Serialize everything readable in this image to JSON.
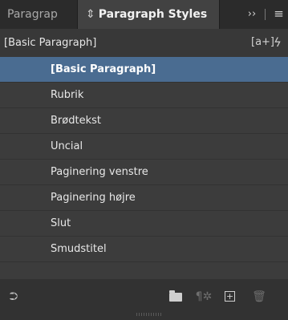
{
  "tabs": {
    "inactive_label": "Paragrap",
    "active_label": "Paragraph Styles",
    "active_updown_icon": "⇕",
    "collapse_glyph": "››",
    "menu_glyph": "≡"
  },
  "current_style": {
    "name": "[Basic Paragraph]",
    "create_override_glyph": "[a+]",
    "clear_override_glyph": "ϟ"
  },
  "styles": {
    "items": [
      "[Basic Paragraph]",
      "Rubrik",
      "Brødtekst",
      "Uncial",
      "Paginering venstre",
      "Paginering højre",
      "Slut",
      "Smudstitel"
    ],
    "selected": "[Basic Paragraph]"
  },
  "footer": {
    "load_styles_glyph": "⮊",
    "clear_overrides_glyph": "¶✲",
    "new_style_glyph": "+",
    "delete_glyph": "🗑"
  },
  "colors": {
    "selection": "#4a6c91",
    "panel_bg": "#3c3c3c",
    "chrome_bg": "#323232"
  }
}
